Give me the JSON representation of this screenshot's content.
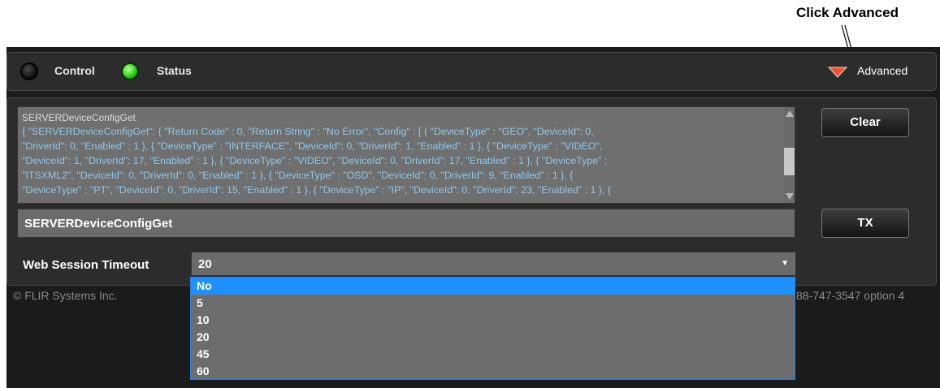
{
  "annotation": {
    "callout": "Click Advanced"
  },
  "topbar": {
    "control_label": "Control",
    "status_label": "Status",
    "advanced_label": "Advanced"
  },
  "console": {
    "log_title": "SERVERDeviceConfigGet",
    "log_lines": [
      " { \"SERVERDeviceConfigGet\": { \"Return Code\" : 0, \"Return String\" : \"No Error\", \"Config\" : [ { \"DeviceType\" : \"GEO\", \"DeviceId\": 0,",
      "\"DriverId\": 0, \"Enabled\" : 1 }, { \"DeviceType\" : \"INTERFACE\", \"DeviceId\": 0, \"DriverId\": 1, \"Enabled\" : 1 }, { \"DeviceType\" : \"VIDEO\",",
      "\"DeviceId\": 1, \"DriverId\": 17, \"Enabled\" : 1 }, { \"DeviceType\" : \"VIDEO\", \"DeviceId\": 0, \"DriverId\": 17, \"Enabled\" : 1 }, { \"DeviceType\" :",
      "\"ITSXML2\", \"DeviceId\": 0, \"DriverId\": 0, \"Enabled\" : 1 }, { \"DeviceType\" : \"OSD\", \"DeviceId\": 0, \"DriverId\": 9, \"Enabled\" : 1 }, {",
      "\"DeviceType\" : \"PT\", \"DeviceId\": 0, \"DriverId\": 15, \"Enabled\" : 1 }, { \"DeviceType\" : \"IP\", \"DeviceId\": 0, \"DriverId\": 23, \"Enabled\" : 1 }, {"
    ],
    "command_value": "SERVERDeviceConfigGet",
    "clear_label": "Clear",
    "tx_label": "TX"
  },
  "timeout": {
    "label": "Web Session Timeout",
    "selected": "20",
    "arrow": "▼",
    "options": [
      "No",
      "5",
      "10",
      "20",
      "45",
      "60"
    ],
    "highlighted": "No"
  },
  "footer": {
    "copyright": "© FLIR Systems Inc.",
    "phone": "88-747-3547 option 4"
  },
  "colors": {
    "status_led": "#2fcf1a",
    "advanced_icon": "#e8553a",
    "log_text": "#8fc8ec",
    "dropdown_highlight": "#1e90ff"
  },
  "icons": {
    "control_led": "led-off-icon",
    "status_led": "led-on-icon",
    "advanced": "triangle-down-icon"
  }
}
